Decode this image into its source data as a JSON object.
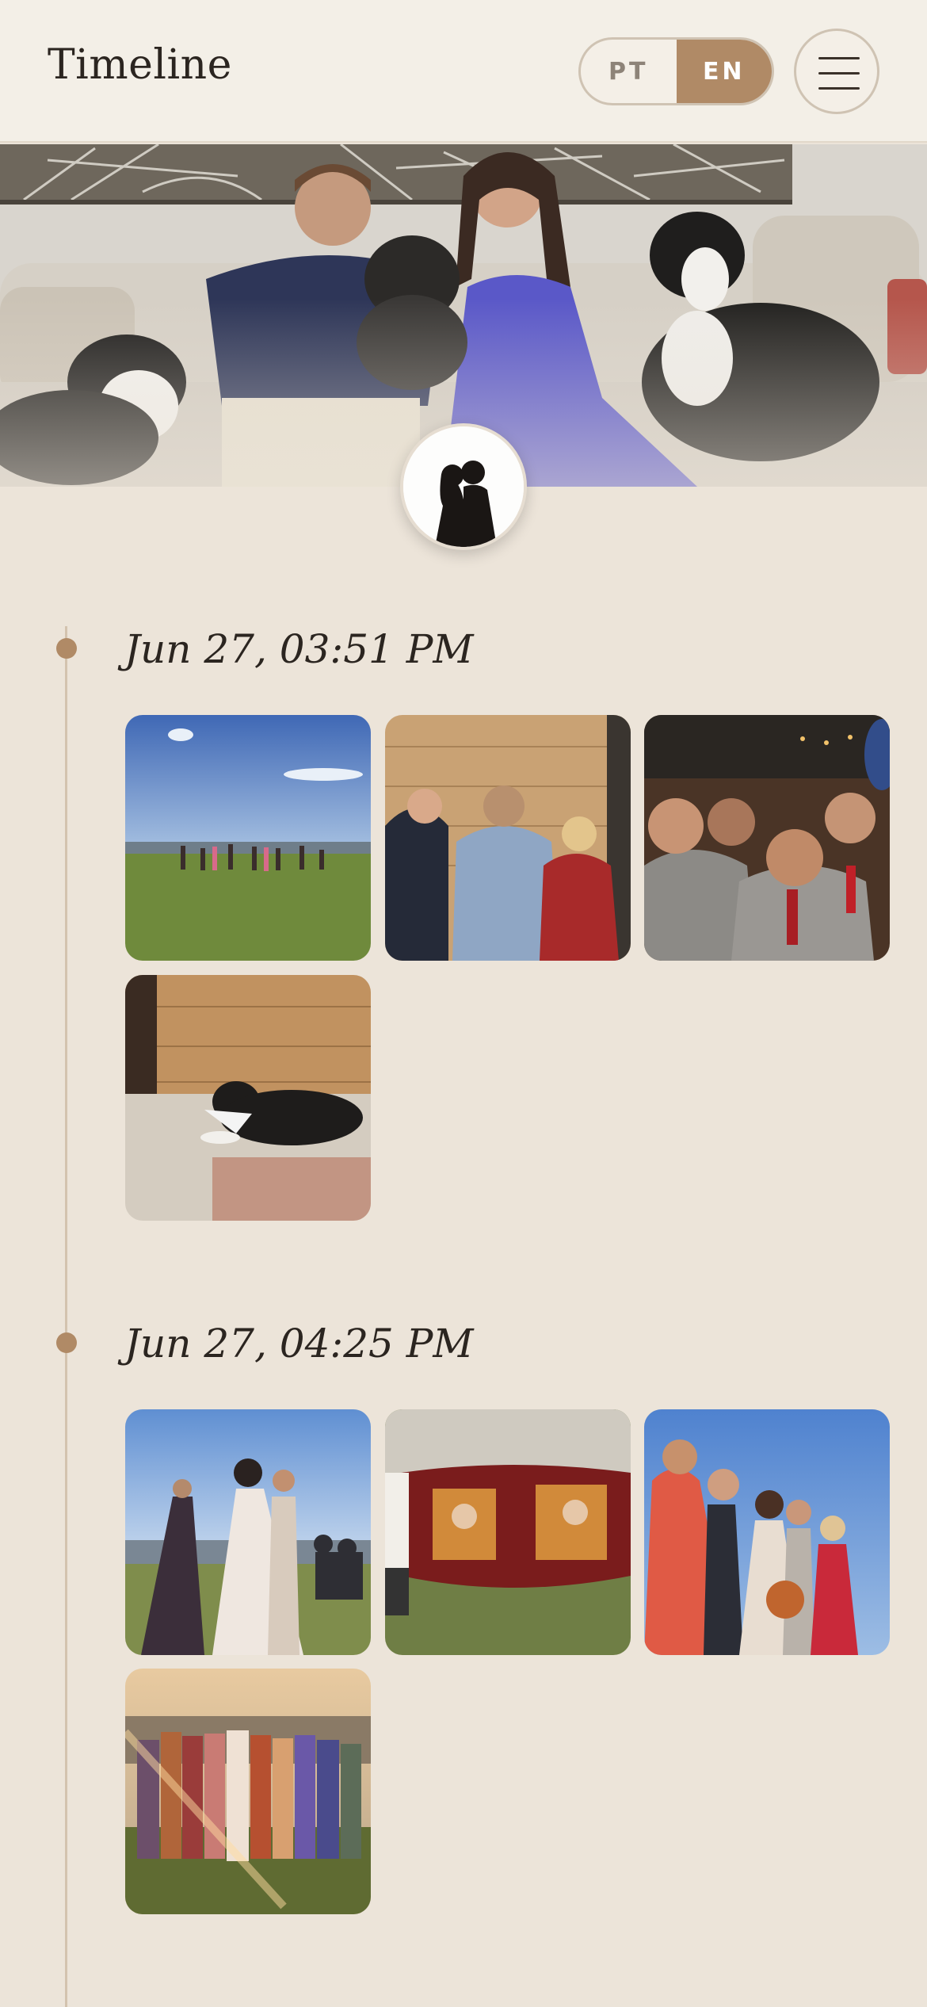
{
  "header": {
    "title": "Timeline",
    "lang": {
      "options": [
        "PT",
        "EN"
      ],
      "active": "EN"
    },
    "menu_icon": "hamburger-menu-icon"
  },
  "hero": {
    "image": "couple-with-dogs-on-sofa",
    "avatar": "kissing-silhouette-avatar"
  },
  "timeline": [
    {
      "time": "Jun 27, 03:51 PM",
      "photos": [
        "ceremony-field-guests",
        "groomsmen-in-barn",
        "group-selfie-grooms",
        "dog-with-bandana"
      ]
    },
    {
      "time": "Jun 27, 04:25 PM",
      "photos": [
        "bride-and-groom-at-altar",
        "beer-bar-cart",
        "family-portrait-outdoors",
        "bridesmaids-sunset"
      ]
    }
  ],
  "colors": {
    "accent": "#b08a66",
    "background": "#ece4d9",
    "header_bg": "#f3efe7",
    "text": "#2b2520"
  }
}
